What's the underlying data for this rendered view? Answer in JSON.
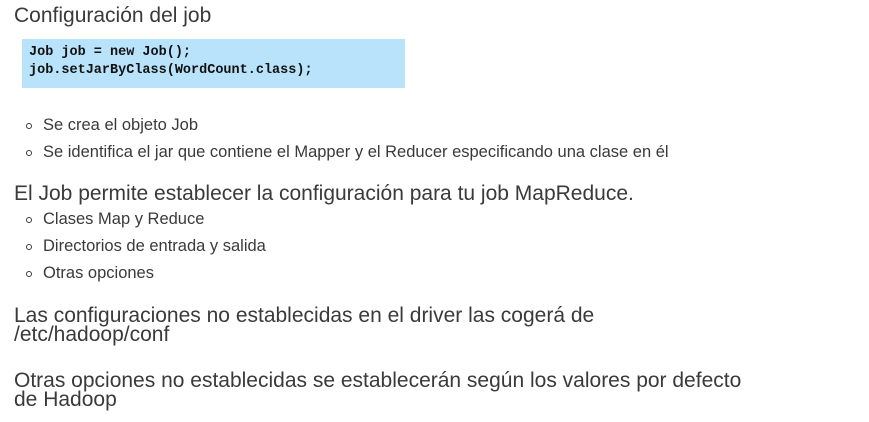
{
  "slide": {
    "heading": "Configuración del job",
    "code_lines": [
      "Job job = new Job();",
      "job.setJarByClass(WordCount.class);"
    ],
    "bullets_a": [
      "Se crea el objeto Job",
      "Se identifica el jar que contiene el Mapper y el Reducer especificando una clase en él"
    ],
    "paragraph_1": "El Job permite establecer la configuración para tu job MapReduce.",
    "bullets_b": [
      "Clases Map y Reduce",
      "Directorios de entrada y salida",
      "Otras opciones"
    ],
    "paragraph_2": [
      "Las configuraciones no establecidas en el driver las cogerá de",
      "/etc/hadoop/conf"
    ],
    "paragraph_3": [
      "Otras opciones no establecidas se establecerán según los valores por defecto",
      "de Hadoop"
    ]
  }
}
